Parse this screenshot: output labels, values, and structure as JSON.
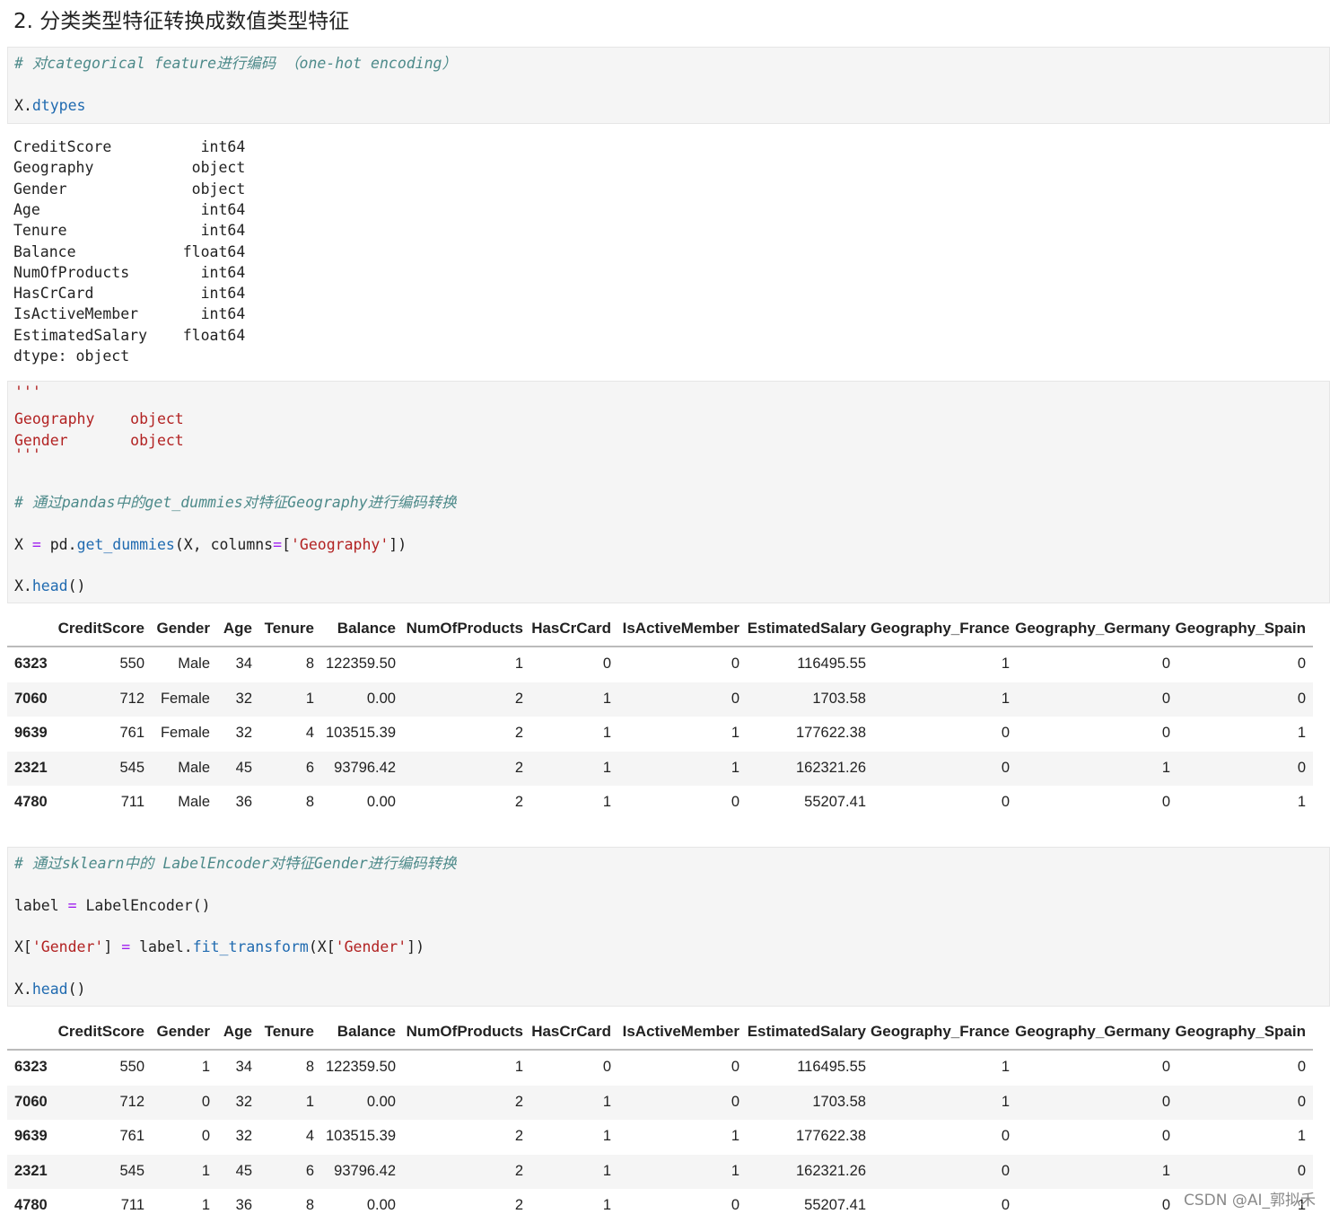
{
  "heading": "2. 分类类型特征转换成数值类型特征",
  "cell1": {
    "comment": "# 对categorical feature进行编码 （one-hot encoding）",
    "line2_obj": "X",
    "line2_dot": ".",
    "line2_fn": "dtypes"
  },
  "dtypes_output": [
    "CreditScore          int64",
    "Geography           object",
    "Gender              object",
    "Age                  int64",
    "Tenure               int64",
    "Balance            float64",
    "NumOfProducts        int64",
    "HasCrCard            int64",
    "IsActiveMember       int64",
    "EstimatedSalary    float64",
    "dtype: object"
  ],
  "cell2": {
    "quote": "'''",
    "str1": "Geography    object",
    "str2": "Gender       object",
    "comment": "# 通过pandas中的get_dummies对特征Geography进行编码转换",
    "l_X": "X",
    "l_eq": "=",
    "l_pd": "pd.",
    "l_fn": "get_dummies",
    "l_args1": "(X, columns",
    "l_eq2": "=",
    "l_br": "[",
    "l_str": "'Geography'",
    "l_end": "])",
    "h_X": "X.",
    "h_fn": "head",
    "h_p": "()"
  },
  "cell3": {
    "comment": "# 通过sklearn中的 LabelEncoder对特征Gender进行编码转换",
    "a_lbl": "label",
    "a_eq": "=",
    "a_rest": "LabelEncoder()",
    "b_X": "X[",
    "b_str": "'Gender'",
    "b_close": "]",
    "b_eq": "=",
    "b_lbl": "label.",
    "b_fn": "fit_transform",
    "b_args": "(X[",
    "b_str2": "'Gender'",
    "b_end": "])",
    "h_X": "X.",
    "h_fn": "head",
    "h_p": "()"
  },
  "table_columns": [
    "CreditScore",
    "Gender",
    "Age",
    "Tenure",
    "Balance",
    "NumOfProducts",
    "HasCrCard",
    "IsActiveMember",
    "EstimatedSalary",
    "Geography_France",
    "Geography_Germany",
    "Geography_Spain"
  ],
  "table1_rows": [
    {
      "idx": "6323",
      "cells": [
        "550",
        "Male",
        "34",
        "8",
        "122359.50",
        "1",
        "0",
        "0",
        "116495.55",
        "1",
        "0",
        "0"
      ]
    },
    {
      "idx": "7060",
      "cells": [
        "712",
        "Female",
        "32",
        "1",
        "0.00",
        "2",
        "1",
        "0",
        "1703.58",
        "1",
        "0",
        "0"
      ]
    },
    {
      "idx": "9639",
      "cells": [
        "761",
        "Female",
        "32",
        "4",
        "103515.39",
        "2",
        "1",
        "1",
        "177622.38",
        "0",
        "0",
        "1"
      ]
    },
    {
      "idx": "2321",
      "cells": [
        "545",
        "Male",
        "45",
        "6",
        "93796.42",
        "2",
        "1",
        "1",
        "162321.26",
        "0",
        "1",
        "0"
      ]
    },
    {
      "idx": "4780",
      "cells": [
        "711",
        "Male",
        "36",
        "8",
        "0.00",
        "2",
        "1",
        "0",
        "55207.41",
        "0",
        "0",
        "1"
      ]
    }
  ],
  "table2_rows": [
    {
      "idx": "6323",
      "cells": [
        "550",
        "1",
        "34",
        "8",
        "122359.50",
        "1",
        "0",
        "0",
        "116495.55",
        "1",
        "0",
        "0"
      ]
    },
    {
      "idx": "7060",
      "cells": [
        "712",
        "0",
        "32",
        "1",
        "0.00",
        "2",
        "1",
        "0",
        "1703.58",
        "1",
        "0",
        "0"
      ]
    },
    {
      "idx": "9639",
      "cells": [
        "761",
        "0",
        "32",
        "4",
        "103515.39",
        "2",
        "1",
        "1",
        "177622.38",
        "0",
        "0",
        "1"
      ]
    },
    {
      "idx": "2321",
      "cells": [
        "545",
        "1",
        "45",
        "6",
        "93796.42",
        "2",
        "1",
        "1",
        "162321.26",
        "0",
        "1",
        "0"
      ]
    },
    {
      "idx": "4780",
      "cells": [
        "711",
        "1",
        "36",
        "8",
        "0.00",
        "2",
        "1",
        "0",
        "55207.41",
        "0",
        "0",
        "1"
      ]
    }
  ],
  "watermark": "CSDN @AI_郭拟禾"
}
